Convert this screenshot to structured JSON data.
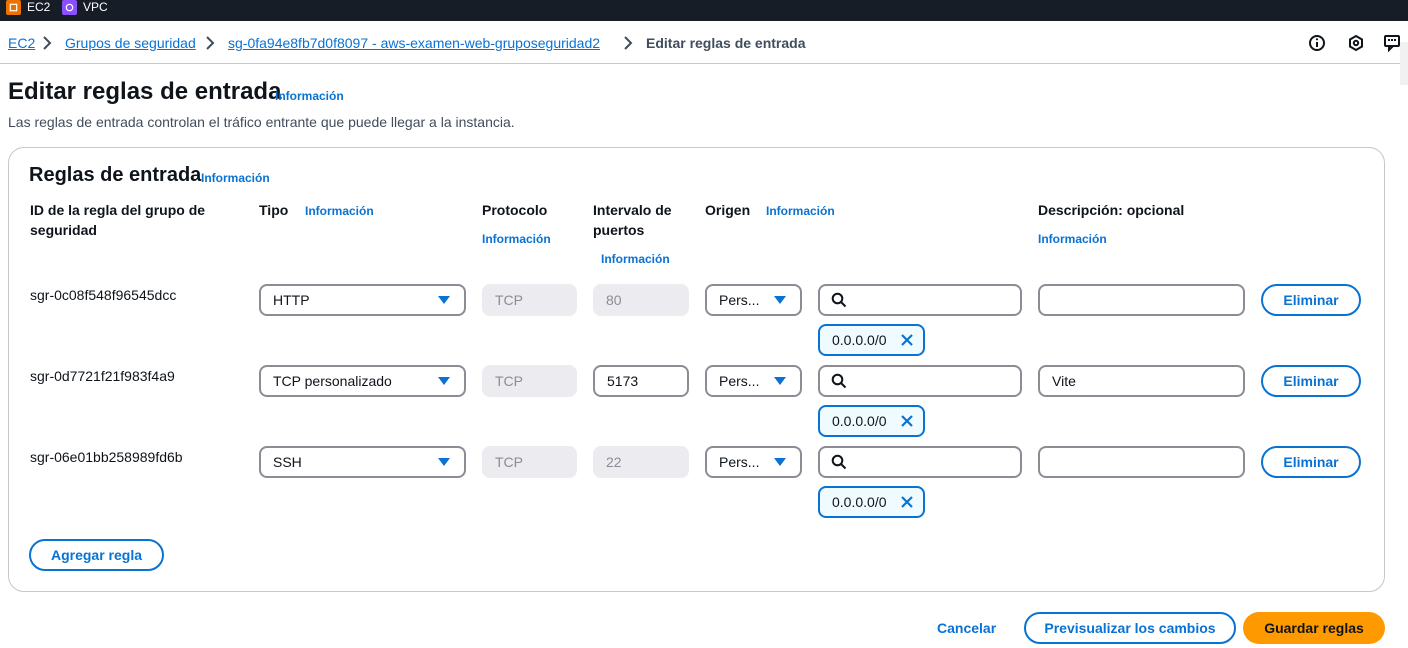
{
  "topbar": {
    "services": [
      {
        "label": "EC2",
        "icon": "ec2-icon",
        "color": "#ed7100"
      },
      {
        "label": "VPC",
        "icon": "vpc-icon",
        "color": "#8c4fff"
      }
    ]
  },
  "breadcrumbs": {
    "items": [
      "EC2",
      "Grupos de seguridad",
      "sg-0fa94e8fb7d0f8097 - aws-examen-web-gruposeguridad2",
      "Editar reglas de entrada"
    ],
    "utility_icons": [
      "info-circle-icon",
      "settings-hexagon-icon",
      "feedback-icon"
    ]
  },
  "page": {
    "title": "Editar reglas de entrada",
    "title_info": "Información",
    "description": "Las reglas de entrada controlan el tráfico entrante que puede llegar a la instancia."
  },
  "panel": {
    "title": "Reglas de entrada",
    "title_info": "Información",
    "columns": {
      "rule_id_line1": "ID de la regla del grupo de",
      "rule_id_line2": "seguridad",
      "type": "Tipo",
      "type_info": "Información",
      "protocol": "Protocolo",
      "protocol_info": "Información",
      "port_line1": "Intervalo de",
      "port_line2": "puertos",
      "port_info": "Información",
      "source": "Origen",
      "source_info": "Información",
      "description": "Descripción: opcional",
      "description_info": "Información"
    },
    "rules": [
      {
        "id": "sgr-0c08f548f96545dcc",
        "type": "HTTP",
        "protocol": "TCP",
        "port": "80",
        "port_editable": false,
        "source": "Pers...",
        "search_value": "",
        "cidr": "0.0.0.0/0",
        "description": "",
        "delete": "Eliminar"
      },
      {
        "id": "sgr-0d7721f21f983f4a9",
        "type": "TCP personalizado",
        "protocol": "TCP",
        "port": "5173",
        "port_editable": true,
        "source": "Pers...",
        "search_value": "",
        "cidr": "0.0.0.0/0",
        "description": "Vite",
        "delete": "Eliminar"
      },
      {
        "id": "sgr-06e01bb258989fd6b",
        "type": "SSH",
        "protocol": "TCP",
        "port": "22",
        "port_editable": false,
        "source": "Pers...",
        "search_value": "",
        "cidr": "0.0.0.0/0",
        "description": "",
        "delete": "Eliminar"
      }
    ],
    "add_rule": "Agregar regla"
  },
  "footer": {
    "cancel": "Cancelar",
    "preview": "Previsualizar los cambios",
    "save": "Guardar reglas"
  },
  "colors": {
    "link": "#0972d3",
    "primary_button": "#ff9900",
    "topbar": "#161d26"
  }
}
